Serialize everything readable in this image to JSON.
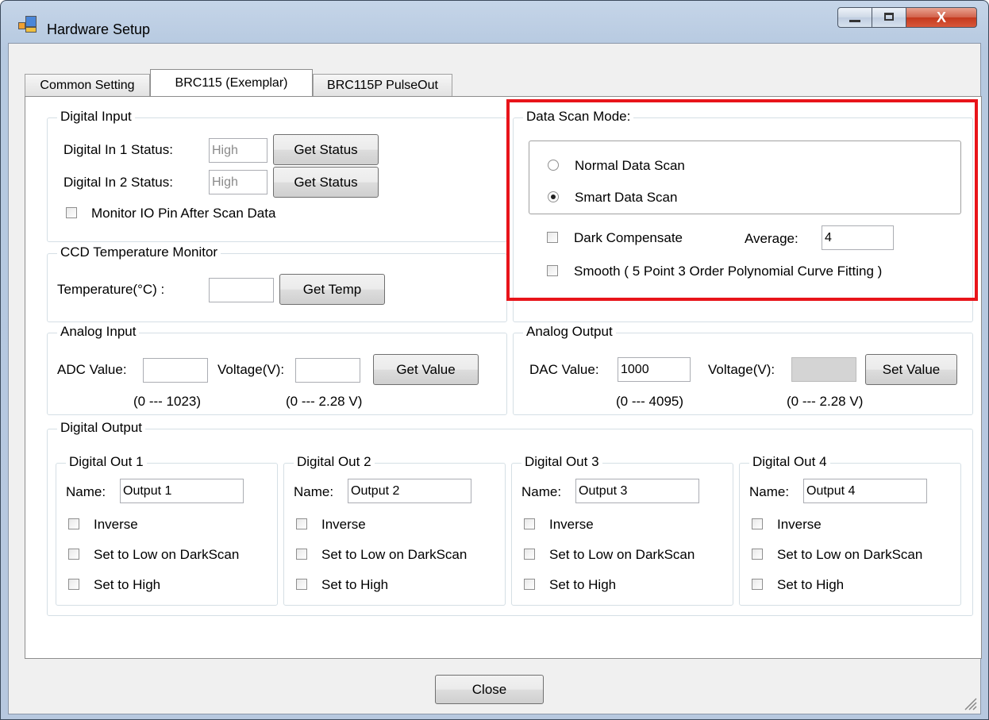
{
  "window": {
    "title": "Hardware Setup"
  },
  "title_controls": {
    "minimize": "_",
    "maximize": "▫",
    "close": "X"
  },
  "tabs": [
    {
      "label": "Common Setting",
      "active": false
    },
    {
      "label": "BRC115 (Exemplar)",
      "active": true
    },
    {
      "label": "BRC115P PulseOut",
      "active": false
    }
  ],
  "digital_input": {
    "title": "Digital Input",
    "in1_label": "Digital In 1 Status:",
    "in1_value": "High",
    "in2_label": "Digital In 2 Status:",
    "in2_value": "High",
    "get_status": "Get Status",
    "monitor_label": "Monitor IO Pin After Scan Data",
    "monitor_checked": false
  },
  "ccd": {
    "title": "CCD Temperature Monitor",
    "temp_label": "Temperature(°C) :",
    "temp_value": "",
    "get_temp": "Get Temp"
  },
  "data_scan": {
    "title": "Data Scan Mode:",
    "normal": "Normal Data Scan",
    "smart": "Smart Data Scan",
    "selected": "smart",
    "dark_label": "Dark Compensate",
    "dark_checked": false,
    "average_label": "Average:",
    "average_value": "4",
    "smooth_label": "Smooth ( 5 Point 3 Order Polynomial Curve Fitting )",
    "smooth_checked": false
  },
  "analog_input": {
    "title": "Analog Input",
    "adc_label": "ADC Value:",
    "adc_value": "",
    "voltage_label": "Voltage(V):",
    "voltage_value": "",
    "get_value": "Get Value",
    "adc_range": "(0 --- 1023)",
    "voltage_range": "(0 --- 2.28 V)"
  },
  "analog_output": {
    "title": "Analog Output",
    "dac_label": "DAC Value:",
    "dac_value": "1000",
    "voltage_label": "Voltage(V):",
    "voltage_value": "",
    "set_value": "Set Value",
    "dac_range": "(0 --- 4095)",
    "voltage_range": "(0 --- 2.28 V)"
  },
  "digital_output": {
    "title": "Digital Output",
    "name_label": "Name:",
    "inverse_label": "Inverse",
    "low_label": "Set to Low on DarkScan",
    "high_label": "Set to High",
    "outputs": [
      {
        "title": "Digital Out  1",
        "name": "Output 1"
      },
      {
        "title": "Digital Out  2",
        "name": "Output 2"
      },
      {
        "title": "Digital Out  3",
        "name": "Output 3"
      },
      {
        "title": "Digital Out  4",
        "name": "Output 4"
      }
    ]
  },
  "footer": {
    "close": "Close"
  },
  "colors": {
    "highlight": "#e8141a",
    "title_bar": "#b9cce3",
    "close_button": "#c4391e"
  }
}
